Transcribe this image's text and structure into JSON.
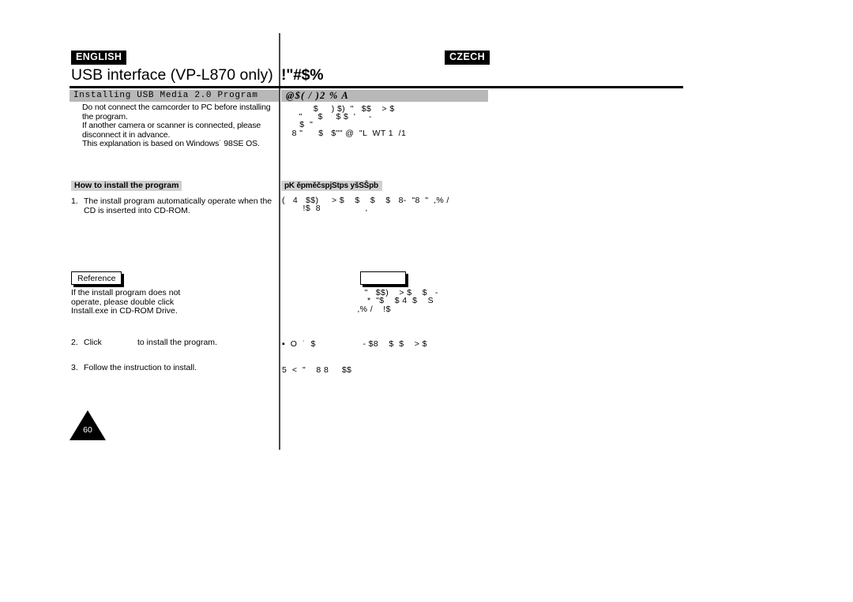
{
  "page": {
    "number": "60"
  },
  "languages": {
    "left_tag": "ENGLISH",
    "right_tag": "CZECH"
  },
  "chapter": {
    "title_en": "USB interface (VP-L870 only)",
    "title_cz": "!\"#$%"
  },
  "left_column": {
    "section_banner": "Installing USB Media 2.0 Program",
    "intro_paragraph": "Do not connect the camcorder to PC before installing the program.\nIf another camera or scanner is connected, please disconnect it in advance.\nThis explanation is based on Windows˙ 98SE OS.",
    "subheading": "How to install the program",
    "steps": [
      {
        "number": "1.",
        "text": "The install program automatically operate when the CD is inserted into CD-ROM."
      },
      {
        "number": "2.",
        "text_before": "Click",
        "text_after": "to install the program."
      },
      {
        "number": "3.",
        "text": "Follow the instruction to install."
      }
    ],
    "reference": {
      "label": "Reference",
      "body": "If the install program does not\noperate, please double click\nInstall.exe in CD-ROM Drive."
    }
  },
  "right_column": {
    "section_banner": "@$( / )2  % A",
    "intro_lines": [
      "      $     ) $)  \"   $$    > $",
      "  \"      $     $ $  '     -",
      "    $  \"",
      "  8 \"      $   $\"\" @  \"L  WT 1  /1"
    ],
    "subheading": "pK ěpměčspjStps yšSŠpb",
    "step_lines": [
      "(   4   $$)     > $    $    $    $   8-  \"8  \"  ,% /",
      "        !$  8                 ,"
    ],
    "reference": {
      "label": "",
      "body_lines": [
        "  \"   $$)    > $    $   -",
        "   *  \"$    $ 4  $    S",
        " ,% /    !$"
      ]
    },
    "footer_lines": [
      "▪  O  ˙  $                  - $8    $  $    > $",
      "5  <  \"    8 8     $$"
    ]
  }
}
